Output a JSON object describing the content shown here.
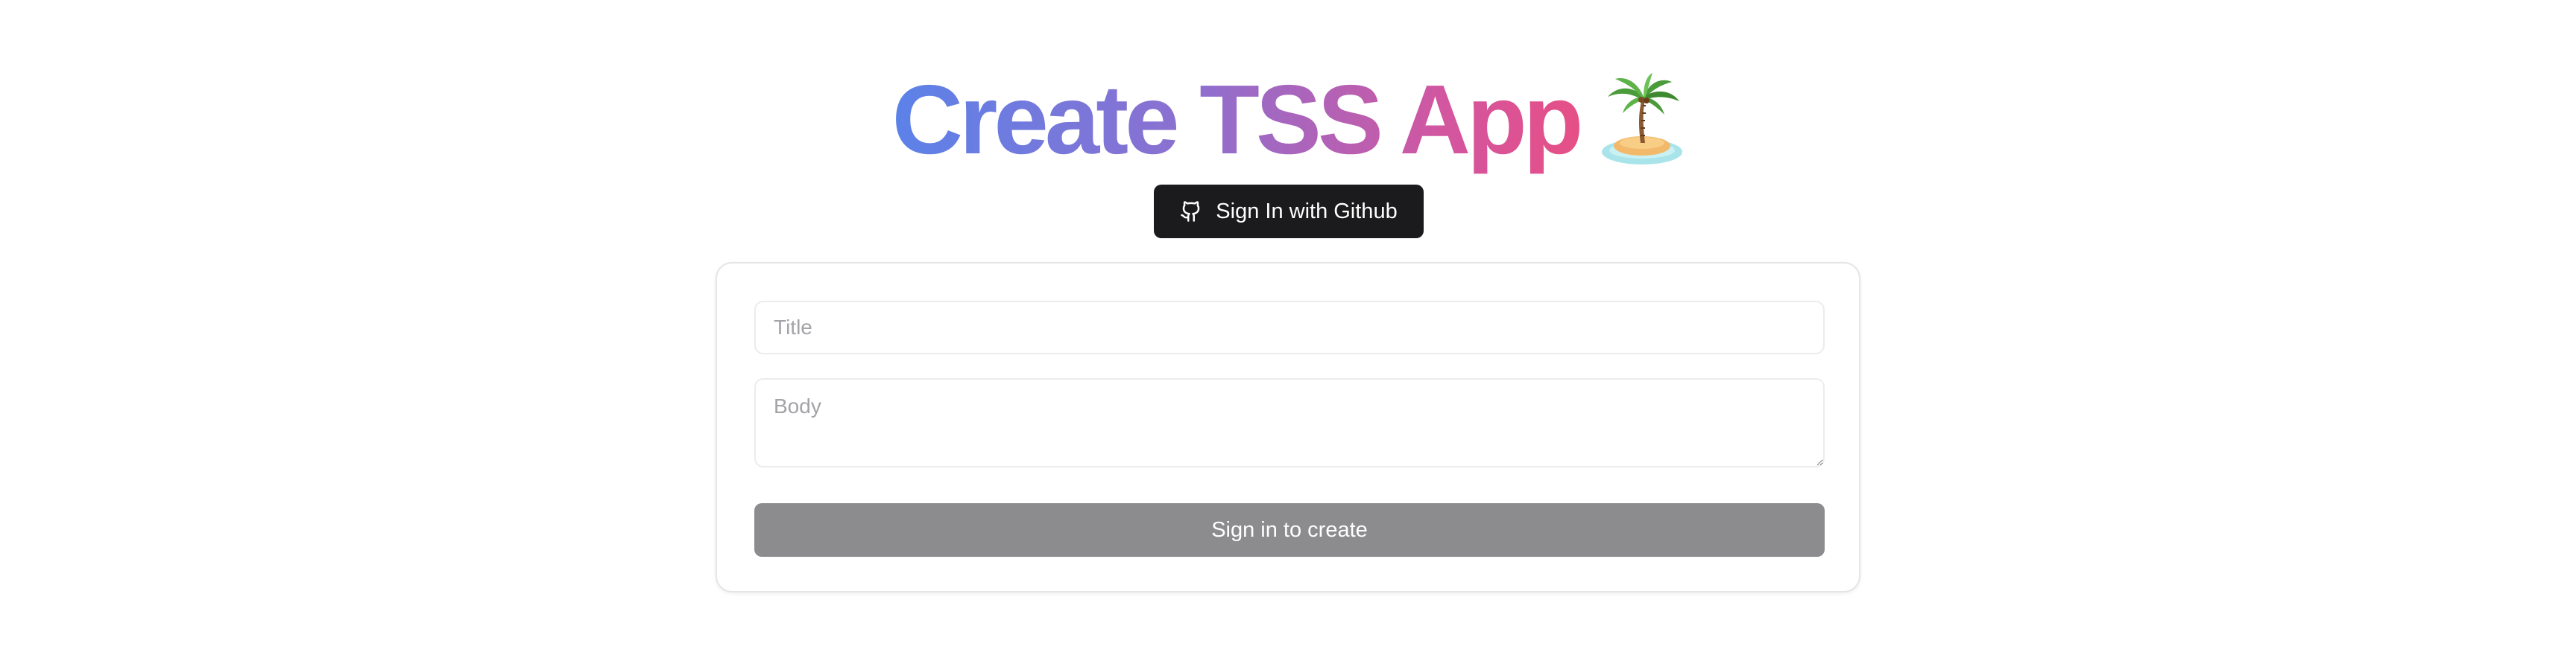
{
  "header": {
    "title": "Create TSS App",
    "title_gradient": [
      "#5b82e9",
      "#8f6fce",
      "#d256a0",
      "#e64f86"
    ],
    "emoji_icon": "desert-island-icon"
  },
  "auth": {
    "github_button_label": "Sign In with Github",
    "github_icon": "github-icon",
    "button_color": "#1b1b1d"
  },
  "form": {
    "title_placeholder": "Title",
    "title_value": "",
    "body_placeholder": "Body",
    "body_value": "",
    "submit_label": "Sign in to create",
    "submit_color": "#8c8c8e"
  }
}
